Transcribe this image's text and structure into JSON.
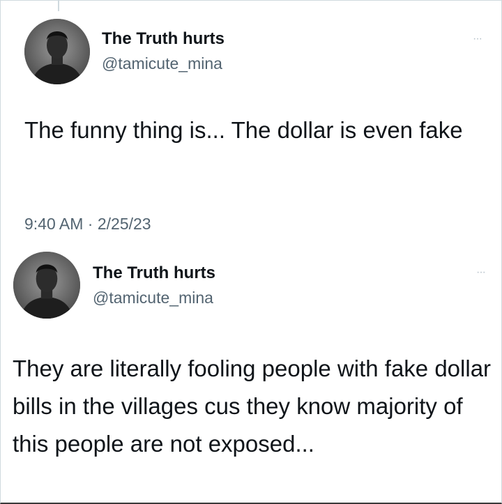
{
  "tweets": [
    {
      "author": {
        "name": "The Truth hurts",
        "handle": "@tamicute_mina"
      },
      "more_icon": "more-horizontal-icon",
      "more_label": "···",
      "text": "The funny thing is... The dollar is even fake",
      "time": "9:40 AM",
      "separator": "·",
      "date": "2/25/23"
    },
    {
      "author": {
        "name": "The Truth hurts",
        "handle": "@tamicute_mina"
      },
      "more_icon": "more-horizontal-icon",
      "more_label": "···",
      "text": "They are literally fooling people with fake dollar bills in the villages cus they know majority of this people are not exposed..."
    }
  ],
  "colors": {
    "text": "#0f1419",
    "secondary": "#536471",
    "border": "#cfd9de",
    "more_icon": "#b7c2ca"
  }
}
